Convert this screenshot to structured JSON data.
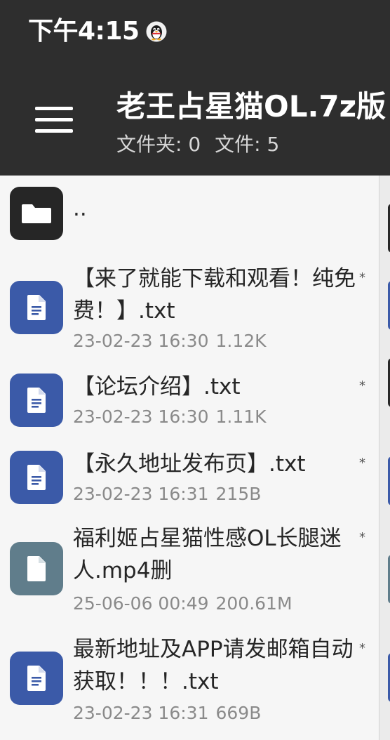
{
  "status_bar": {
    "time": "下午4:15",
    "notification_icon": "qq-penguin-icon"
  },
  "toolbar": {
    "menu_icon": "hamburger-menu-icon",
    "title": "老王占星猫OL.7z版",
    "folders_label": "文件夹: 0",
    "files_label": "文件: 5"
  },
  "colors": {
    "toolbar_bg": "#2e2e2e",
    "list_bg": "#f6f6f6",
    "folder_icon_bg": "#262626",
    "text_icon_bg": "#3b5aa8",
    "generic_file_icon_bg": "#607d8b"
  },
  "file_list": {
    "parent_dir": {
      "name": "..",
      "icon": "folder-icon"
    },
    "items": [
      {
        "name": "【来了就能下载和观看！纯免费！】.txt",
        "date": "23-02-23 16:30",
        "size": "1.12K",
        "flag": "*",
        "icon": "text-file-icon"
      },
      {
        "name": "【论坛介绍】.txt",
        "date": "23-02-23 16:30",
        "size": "1.11K",
        "flag": "*",
        "icon": "text-file-icon"
      },
      {
        "name": "【永久地址发布页】.txt",
        "date": "23-02-23 16:31",
        "size": "215B",
        "flag": "*",
        "icon": "text-file-icon"
      },
      {
        "name": "福利姬占星猫性感OL长腿迷人.mp4删",
        "date": "25-06-06 00:49",
        "size": "200.61M",
        "flag": "*",
        "icon": "file-icon"
      },
      {
        "name": "最新地址及APP请发邮箱自动获取！！！.txt",
        "date": "23-02-23 16:31",
        "size": "669B",
        "flag": "*",
        "icon": "text-file-icon"
      }
    ]
  }
}
